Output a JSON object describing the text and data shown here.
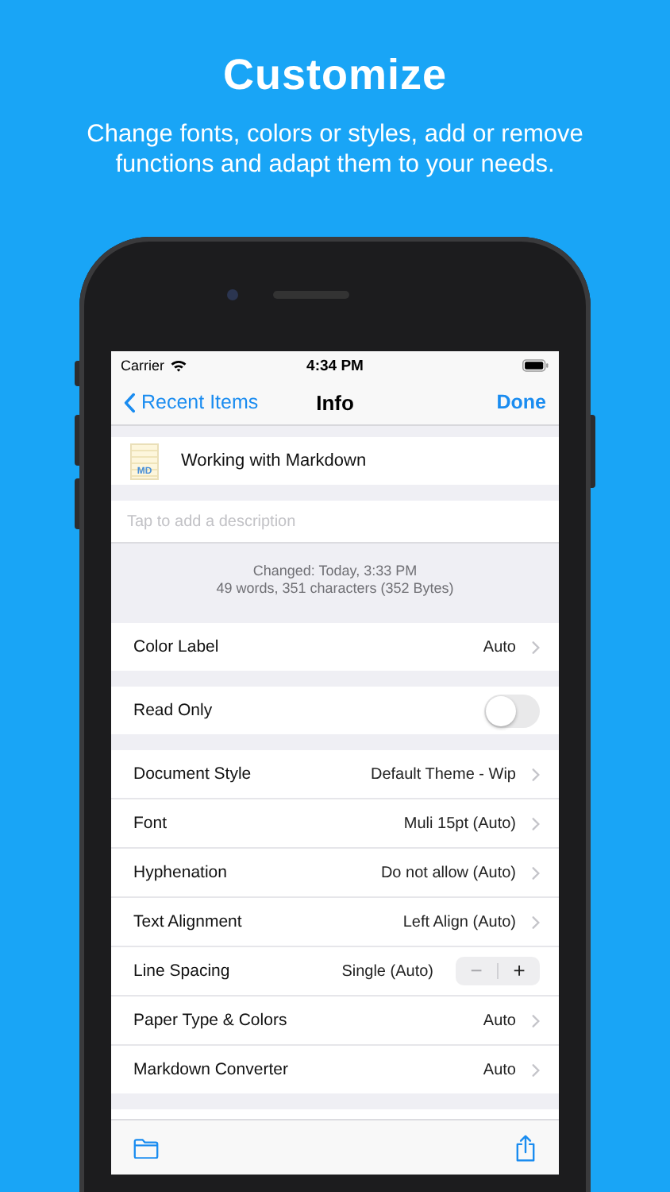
{
  "header": {
    "title": "Customize",
    "subtitle": "Change fonts, colors or styles, add or remove functions and adapt them to your needs."
  },
  "status_bar": {
    "carrier": "Carrier",
    "time": "4:34 PM"
  },
  "nav": {
    "back": "Recent Items",
    "title": "Info",
    "done": "Done"
  },
  "document": {
    "badge": "MD",
    "name": "Working with Markdown"
  },
  "description": {
    "placeholder": "Tap to add a description"
  },
  "stats": [
    "Changed: Today, 3:33 PM",
    "49 words, 351 characters (352 Bytes)"
  ],
  "sections": [
    [
      {
        "kind": "disclosure",
        "label": "Color Label",
        "value": "Auto"
      }
    ],
    [
      {
        "kind": "toggle",
        "label": "Read Only",
        "on": false
      }
    ],
    [
      {
        "kind": "disclosure",
        "label": "Document Style",
        "value": "Default Theme - Wip"
      },
      {
        "kind": "disclosure",
        "label": "Font",
        "value": "Muli 15pt (Auto)"
      },
      {
        "kind": "disclosure",
        "label": "Hyphenation",
        "value": "Do not allow (Auto)"
      },
      {
        "kind": "disclosure",
        "label": "Text Alignment",
        "value": "Left Align (Auto)"
      },
      {
        "kind": "stepper",
        "label": "Line Spacing",
        "value": "Single (Auto)",
        "decrement": {
          "label": "−",
          "disabled": true
        },
        "increment": {
          "label": "+",
          "disabled": false
        }
      },
      {
        "kind": "disclosure",
        "label": "Paper Type & Colors",
        "value": "Auto"
      },
      {
        "kind": "disclosure",
        "label": "Markdown Converter",
        "value": "Auto"
      }
    ]
  ]
}
